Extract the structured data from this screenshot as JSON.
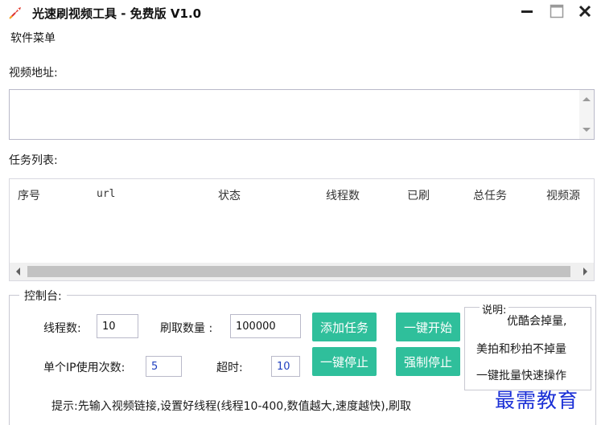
{
  "window": {
    "title": "光速刷视频工具 - 免费版 V1.0",
    "controls": [
      "minimize",
      "maximize",
      "close"
    ]
  },
  "menu": {
    "items": [
      "软件菜单"
    ]
  },
  "url_section": {
    "label": "视频地址:",
    "value": ""
  },
  "task_section": {
    "label": "任务列表:",
    "columns": [
      "序号",
      "url",
      "状态",
      "线程数",
      "已刷",
      "总任务",
      "视频源"
    ]
  },
  "console": {
    "title": "控制台:",
    "threads_label": "线程数:",
    "threads_value": "10",
    "count_label": "刷取数量 :",
    "count_value": "100000",
    "ip_label": "单个IP使用次数:",
    "ip_value": "5",
    "timeout_label": "超时:",
    "timeout_value": "10",
    "buttons": {
      "add_task": "添加任务",
      "start_all": "一键开始",
      "stop_all": "一键停止",
      "force_stop": "强制停止"
    },
    "notes": {
      "title": "说明:",
      "lines": [
        "优酷会掉量,",
        "美拍和秒拍不掉量",
        "一键批量快速操作"
      ]
    },
    "tip": "提示:先输入视频链接,设置好线程(线程10-400,数值越大,速度越快),刷取"
  },
  "watermark": "最需教育",
  "colors": {
    "button_green": "#2fbf9b",
    "watermark_blue": "#1a2fd6",
    "field_blue_text": "#1f3fbf"
  }
}
